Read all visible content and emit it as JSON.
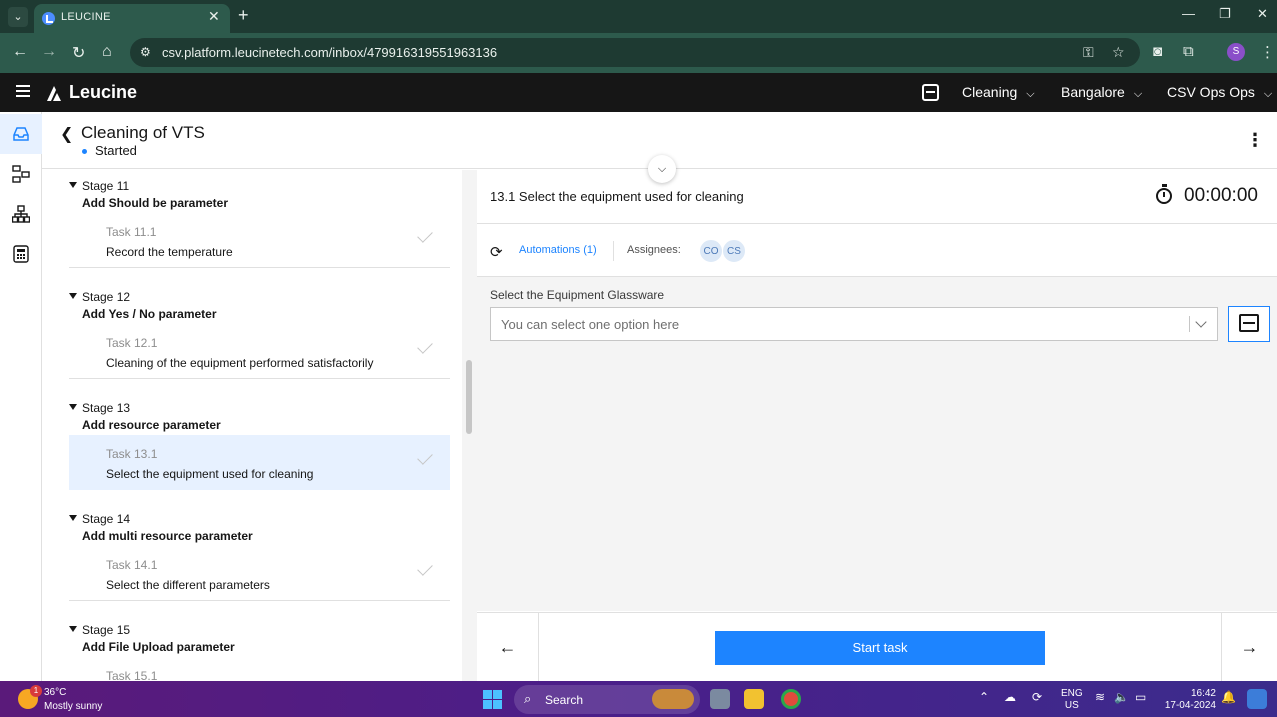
{
  "browser": {
    "tab_title": "LEUCINE",
    "tab_close": "✕",
    "new_tab": "+",
    "url": "csv.platform.leucinetech.com/inbox/479916319551963136",
    "window_controls": [
      "—",
      "❐",
      "✕"
    ],
    "profile_initial": "S"
  },
  "header": {
    "logo_text": "Leucine",
    "dropdowns": [
      {
        "label": "Cleaning"
      },
      {
        "label": "Bangalore"
      },
      {
        "label": "CSV Ops Ops"
      }
    ]
  },
  "page": {
    "title": "Cleaning of VTS",
    "status": "Started"
  },
  "stages": [
    {
      "stage": "Stage 11",
      "name": "Add Should be parameter",
      "task_num": "Task 11.1",
      "task_name": "Record the temperature"
    },
    {
      "stage": "Stage 12",
      "name": "Add Yes / No parameter",
      "task_num": "Task 12.1",
      "task_name": "Cleaning of the equipment performed satisfactorily"
    },
    {
      "stage": "Stage 13",
      "name": "Add resource parameter",
      "task_num": "Task 13.1",
      "task_name": "Select the equipment used for cleaning"
    },
    {
      "stage": "Stage 14",
      "name": "Add multi resource parameter",
      "task_num": "Task 14.1",
      "task_name": "Select the different parameters"
    },
    {
      "stage": "Stage 15",
      "name": "Add File Upload parameter",
      "task_num": "Task 15.1",
      "task_name": ""
    }
  ],
  "task": {
    "title": "13.1 Select the equipment used for cleaning",
    "timer": "00:00:00",
    "automations_label": "Automations (1)",
    "assignees_label": "Assignees:",
    "assignees": [
      "CO",
      "CS"
    ],
    "field_label": "Select the Equipment Glassware",
    "select_placeholder": "You can select one option here",
    "start_label": "Start task"
  },
  "taskbar": {
    "weather_temp": "36°C",
    "weather_desc": "Mostly sunny",
    "weather_badge": "1",
    "search_label": "Search",
    "lang_top": "ENG",
    "lang_bottom": "US",
    "time": "16:42",
    "date": "17-04-2024"
  }
}
